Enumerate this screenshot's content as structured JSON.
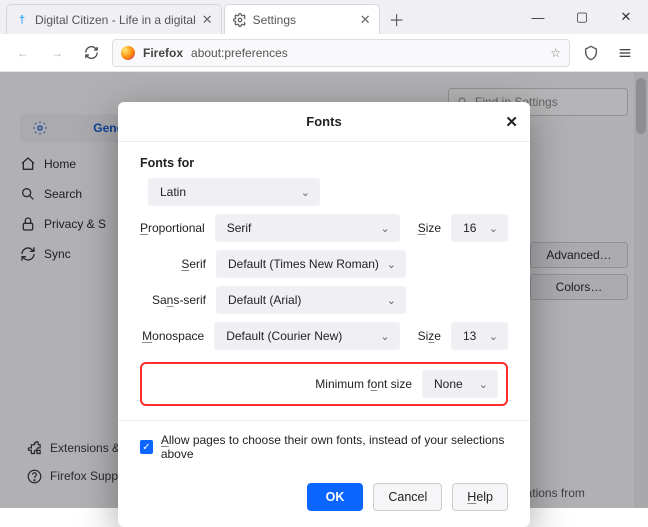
{
  "tabs": {
    "items": [
      {
        "label": "Digital Citizen - Life in a digital"
      },
      {
        "label": "Settings"
      }
    ]
  },
  "windowControls": {
    "min": "—",
    "max": "▢",
    "close": "✕"
  },
  "urlbar": {
    "host": "Firefox",
    "path": "about:preferences"
  },
  "findBox": {
    "placeholder": "Find in Settings"
  },
  "sidebar": {
    "items": [
      {
        "label": "General"
      },
      {
        "label": "Home"
      },
      {
        "label": "Search"
      },
      {
        "label": "Privacy & Security"
      },
      {
        "label": "Sync"
      }
    ],
    "footer": [
      {
        "label": "Extensions & Themes"
      },
      {
        "label": "Firefox Support"
      }
    ]
  },
  "rightButtons": {
    "advanced": "Advanced…",
    "colors": "Colors…"
  },
  "languagesHint": "Choose the languages used to display menus, messages, and notifications from",
  "modal": {
    "title": "Fonts",
    "fontsFor": "Fonts for",
    "fontsForValue": "Latin",
    "labels": {
      "proportional": "Proportional",
      "serif": "Serif",
      "sans": "Sans-serif",
      "mono": "Monospace",
      "size": "Size",
      "minFont": "Minimum font size"
    },
    "values": {
      "proportional": "Serif",
      "serif": "Default (Times New Roman)",
      "sans": "Default (Arial)",
      "mono": "Default (Courier New)",
      "sizeProp": "16",
      "sizeMono": "13",
      "minFont": "None"
    },
    "allowPages": "Allow pages to choose their own fonts, instead of your selections above",
    "buttons": {
      "ok": "OK",
      "cancel": "Cancel",
      "help": "Help"
    }
  }
}
